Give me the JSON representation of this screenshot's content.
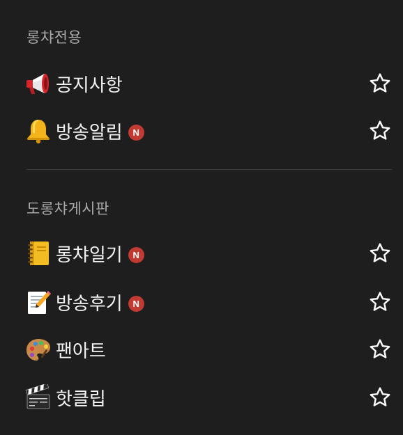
{
  "sections": [
    {
      "title": "롱챠전용",
      "items": [
        {
          "label": "공지사항",
          "icon": "megaphone-icon",
          "new": false,
          "badge": ""
        },
        {
          "label": "방송알림",
          "icon": "bell-icon",
          "new": true,
          "badge": "N"
        }
      ]
    },
    {
      "title": "도롱챠게시판",
      "items": [
        {
          "label": "롱챠일기",
          "icon": "notebook-icon",
          "new": true,
          "badge": "N"
        },
        {
          "label": "방송후기",
          "icon": "memo-icon",
          "new": true,
          "badge": "N"
        },
        {
          "label": "팬아트",
          "icon": "palette-icon",
          "new": false,
          "badge": ""
        },
        {
          "label": "핫클립",
          "icon": "clapper-board-icon",
          "new": false,
          "badge": ""
        }
      ]
    }
  ],
  "colors": {
    "background": "#1e1e1e",
    "section_title": "#a9a9a9",
    "label": "#f4f4f4",
    "badge": "#c23b32",
    "divider": "#3d3d3d",
    "star_outline": "#ffffff"
  }
}
